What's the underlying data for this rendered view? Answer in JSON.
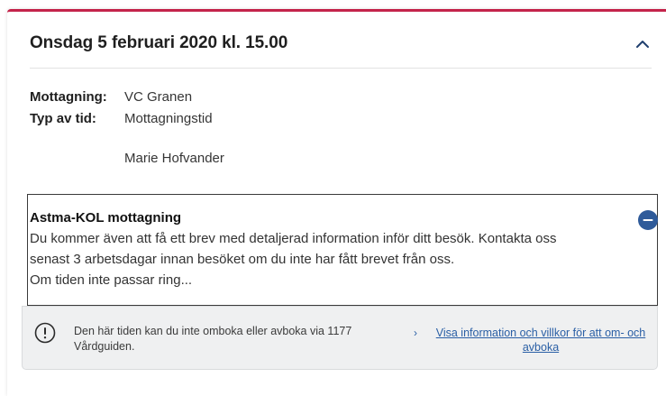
{
  "appointment": {
    "title": "Onsdag 5 februari 2020 kl. 15.00",
    "details": [
      {
        "label": "Mottagning:",
        "value": "VC Granen"
      },
      {
        "label": "Typ av tid:",
        "value": "Mottagningstid"
      }
    ],
    "practitioner": "Marie Hofvander"
  },
  "message": {
    "title": "Astma-KOL mottagning",
    "lines": [
      "Du kommer även att få ett brev med detaljerad information inför ditt besök. Kontakta oss",
      "senast 3 arbetsdagar innan besöket om du inte har fått brevet från oss.",
      "Om tiden inte passar ring..."
    ]
  },
  "notice": {
    "text": "Den här tiden kan du inte omboka eller avboka via 1177 Vårdguiden.",
    "link_text": "Visa information och villkor för att om- och avboka"
  },
  "colors": {
    "accent_border": "#c4234a",
    "link": "#2a5fa5",
    "collapse_button": "#2f5b9a"
  },
  "icons": {
    "header": "chevron-up-icon",
    "message": "minus-circle-icon",
    "notice": "exclamation-circle-icon",
    "link": "chevron-right-icon"
  }
}
